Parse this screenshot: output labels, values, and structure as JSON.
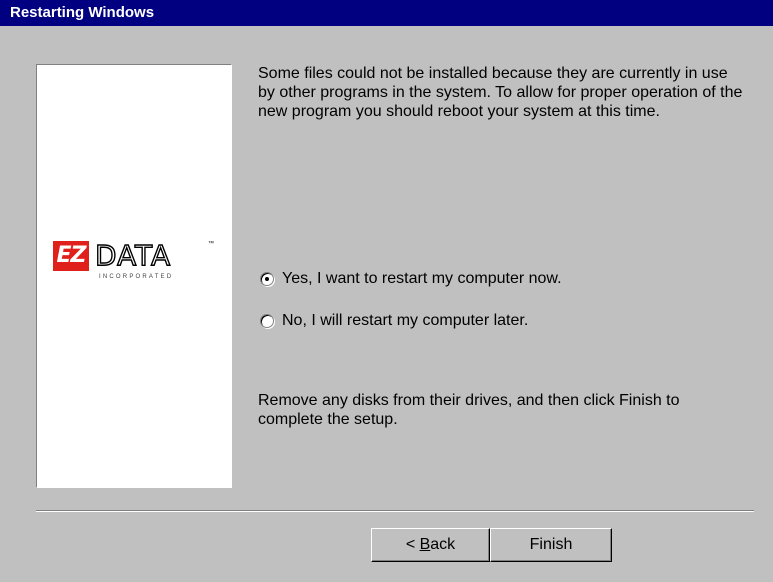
{
  "window": {
    "title": "Restarting Windows"
  },
  "logo": {
    "mark": "EZ",
    "word": "DATA",
    "tm": "™",
    "sub": "INCORPORATED"
  },
  "message": "Some files could not be installed because they are currently in use by other programs in the system. To allow for proper operation of the new program you should reboot your system at this time.",
  "options": [
    {
      "label": "Yes, I want to restart my computer now.",
      "selected": true
    },
    {
      "label": "No, I will restart my computer later.",
      "selected": false
    }
  ],
  "instruction": "Remove any disks from their drives, and then click Finish to complete the setup.",
  "buttons": {
    "back_prefix": "< ",
    "back_mnemonic": "B",
    "back_rest": "ack",
    "finish": "Finish"
  },
  "colors": {
    "titlebar": "#000080",
    "face": "#c0c0c0",
    "logo_red": "#e0201b"
  }
}
